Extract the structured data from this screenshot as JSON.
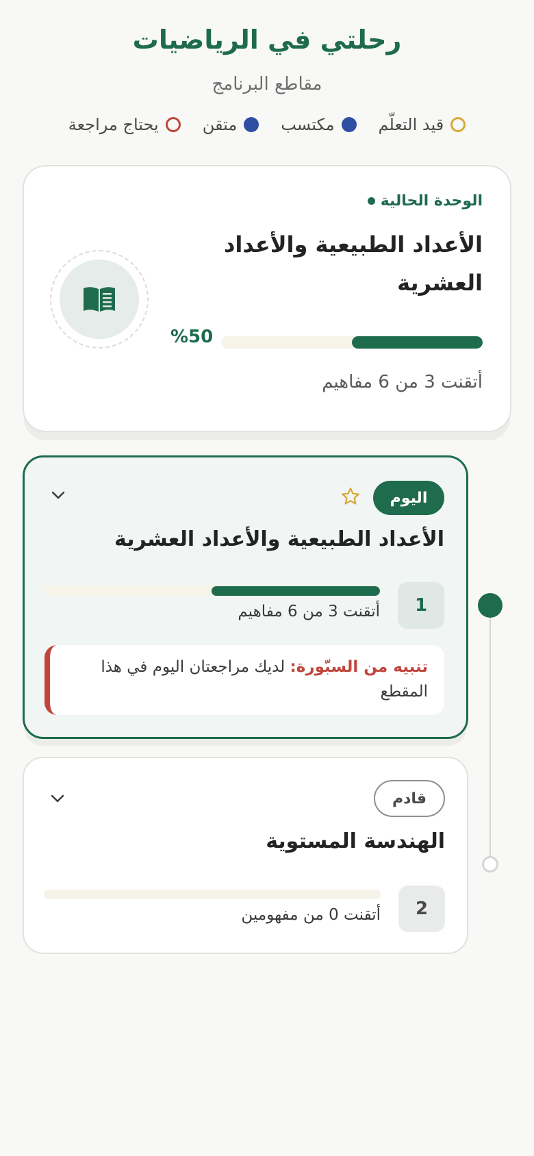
{
  "header": {
    "title": "رحلتي في الرياضيات",
    "subtitle": "مقاطع البرنامج"
  },
  "legend": [
    {
      "label": "قيد التعلّم",
      "color": "#d8a93a",
      "style": "ring"
    },
    {
      "label": "مكتسب",
      "color": "#2f4fa3",
      "style": "filled"
    },
    {
      "label": "متقن",
      "color": "#2f4fa3",
      "style": "filled"
    },
    {
      "label": "يحتاج مراجعة",
      "color": "#c0463c",
      "style": "ring"
    }
  ],
  "current_unit": {
    "label": "الوحدة الحالية",
    "title": "الأعداد الطبيعية والأعداد العشرية",
    "progress_percent": 50,
    "progress_text": "%50",
    "summary": "أتقنت 3 من 6 مفاهيم",
    "icon": "book-icon"
  },
  "sections": [
    {
      "badge": "اليوم",
      "number": "1",
      "title": "الأعداد الطبيعية والأعداد العشرية",
      "progress_fraction": 0.5,
      "summary": "أتقنت 3 من 6 مفاهيم",
      "alert": {
        "title": "تنبيه من السبّورة:",
        "text": "لديك مراجعتان اليوم في هذا المقطع"
      }
    },
    {
      "badge": "قادم",
      "number": "2",
      "title": "الهندسة المستوية",
      "progress_fraction": 0,
      "summary": "أتقنت 0 من مفهومين"
    }
  ],
  "colors": {
    "primary": "#1e6b4e",
    "alert": "#c0463c",
    "learning": "#d8a93a",
    "acquired": "#2f4fa3"
  }
}
